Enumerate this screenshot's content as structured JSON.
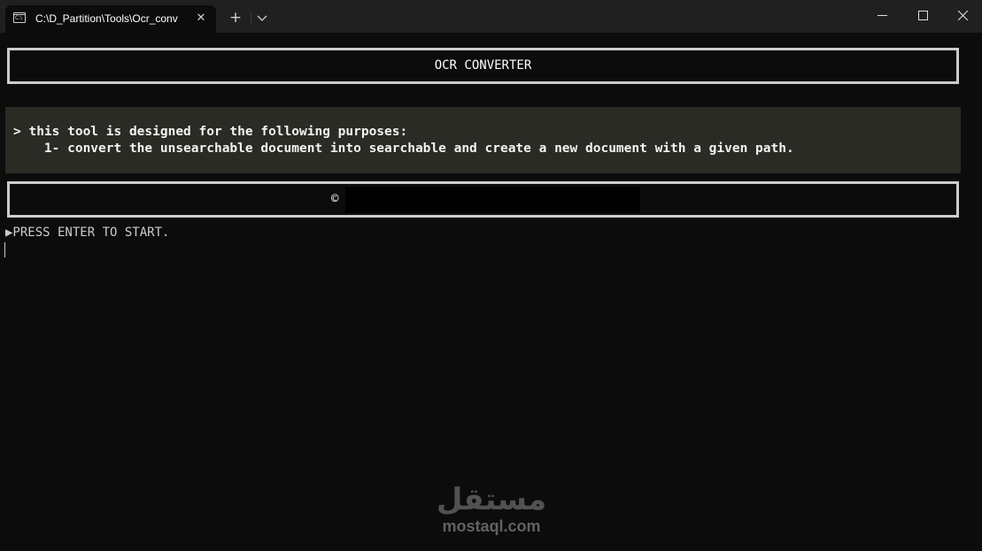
{
  "window": {
    "tab_title": "C:\\D_Partition\\Tools\\Ocr_conv",
    "tab_icon_text": "C:\\",
    "tab_close": "✕",
    "new_tab": "+"
  },
  "console": {
    "header_title": "OCR CONVERTER",
    "description_line1": "> this tool is designed for the following purposes:",
    "description_line2": "    1- convert the unsearchable document into searchable and create a new document with a given path.",
    "copyright_symbol": "©",
    "prompt": "▶PRESS ENTER TO START."
  },
  "watermark": {
    "arabic": "مستقل",
    "latin": "mostaql.com"
  },
  "colors": {
    "titlebar": "#202020",
    "background": "#0c0c0c",
    "description_bg": "#2a2b24",
    "box_border": "#cccccc"
  }
}
